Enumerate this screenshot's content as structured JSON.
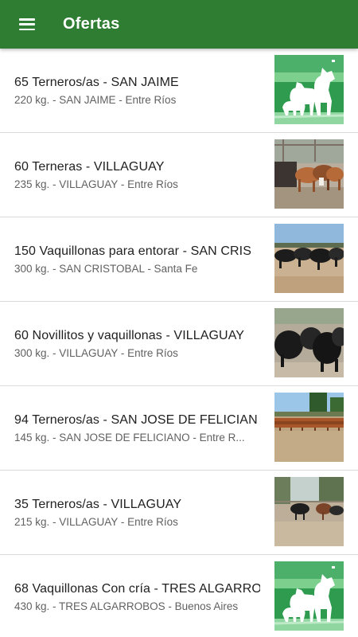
{
  "appbar": {
    "title": "Ofertas",
    "menu_icon": "hamburger-menu-icon",
    "color": "#2e7d32"
  },
  "offers": [
    {
      "title": "65 Terneros/as - SAN JAIME",
      "subtitle": "220 kg. - SAN JAIME - Entre Ríos",
      "thumb": "placeholder-animals"
    },
    {
      "title": "60 Terneras - VILLAGUAY",
      "subtitle": "235 kg. - VILLAGUAY - Entre Ríos",
      "thumb": "photo-cattle-pen"
    },
    {
      "title": "150 Vaquillonas para entorar - SAN CRIS",
      "subtitle": "300 kg. - SAN CRISTOBAL - Santa Fe",
      "thumb": "photo-cattle-field"
    },
    {
      "title": "60 Novillitos y vaquillonas - VILLAGUAY",
      "subtitle": "300 kg. - VILLAGUAY - Entre Ríos",
      "thumb": "photo-black-cattle"
    },
    {
      "title": "94 Terneros/as - SAN JOSE DE FELICIAN",
      "subtitle": "145 kg. - SAN JOSE DE FELICIANO - Entre R...",
      "thumb": "photo-brown-herd"
    },
    {
      "title": "35 Terneros/as - VILLAGUAY",
      "subtitle": "215 kg. - VILLAGUAY - Entre Ríos",
      "thumb": "photo-corral"
    },
    {
      "title": "68 Vaquillonas Con cría - TRES ALGARRO",
      "subtitle": "430 kg. - TRES ALGARROBOS - Buenos Aires",
      "thumb": "placeholder-animals"
    }
  ]
}
